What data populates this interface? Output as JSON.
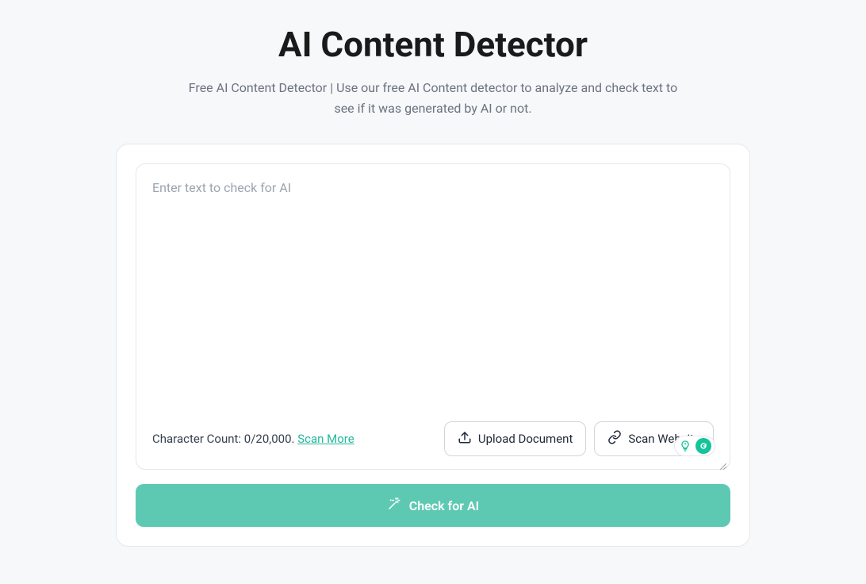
{
  "header": {
    "title": "AI Content Detector",
    "subtitle": "Free AI Content Detector | Use our free AI Content detector to analyze and check text to see if it was generated by AI or not."
  },
  "editor": {
    "placeholder": "Enter text to check for AI",
    "char_count_label": "Character Count: ",
    "char_count_value": "0/20,000.",
    "scan_more_label": "Scan More"
  },
  "actions": {
    "upload_label": "Upload Document",
    "scan_website_label": "Scan Website",
    "check_label": "Check for AI"
  },
  "colors": {
    "accent": "#5ec9b3",
    "link": "#22b89a",
    "bg": "#f7f8fa"
  }
}
